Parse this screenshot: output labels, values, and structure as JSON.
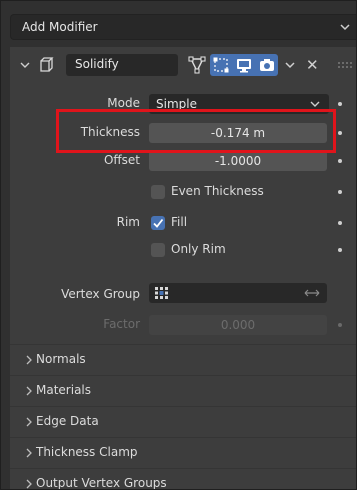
{
  "add_modifier": {
    "label": "Add Modifier",
    "chevron_icon": "chevron-down-icon"
  },
  "modifier": {
    "name": "Solidify",
    "icons": {
      "collapse": "chevron-down-icon",
      "modifier_type": "solidify-modifier-icon",
      "edit_mode": "vertex-triangle-icon",
      "on_cage": "cage-icon",
      "viewport": "monitor-icon",
      "render": "camera-icon",
      "menu": "chevron-down-icon",
      "remove": "close-icon",
      "drag": "grip-icon"
    },
    "toggle_color": "#4772b3"
  },
  "properties": {
    "mode": {
      "label": "Mode",
      "value": "Simple"
    },
    "thickness": {
      "label": "Thickness",
      "value": "-0.174 m"
    },
    "offset": {
      "label": "Offset",
      "value": "-1.0000"
    },
    "even_thickness": {
      "label": "Even Thickness",
      "checked": false
    },
    "rim": {
      "label": "Rim"
    },
    "fill": {
      "label": "Fill",
      "checked": true
    },
    "only_rim": {
      "label": "Only Rim",
      "checked": false
    },
    "vertex_group": {
      "label": "Vertex Group",
      "value": ""
    },
    "factor": {
      "label": "Factor",
      "value": "0.000"
    }
  },
  "subpanels": [
    {
      "label": "Normals"
    },
    {
      "label": "Materials"
    },
    {
      "label": "Edge Data"
    },
    {
      "label": "Thickness Clamp"
    },
    {
      "label": "Output Vertex Groups"
    }
  ],
  "annotation": {
    "color": "#e0141b"
  }
}
